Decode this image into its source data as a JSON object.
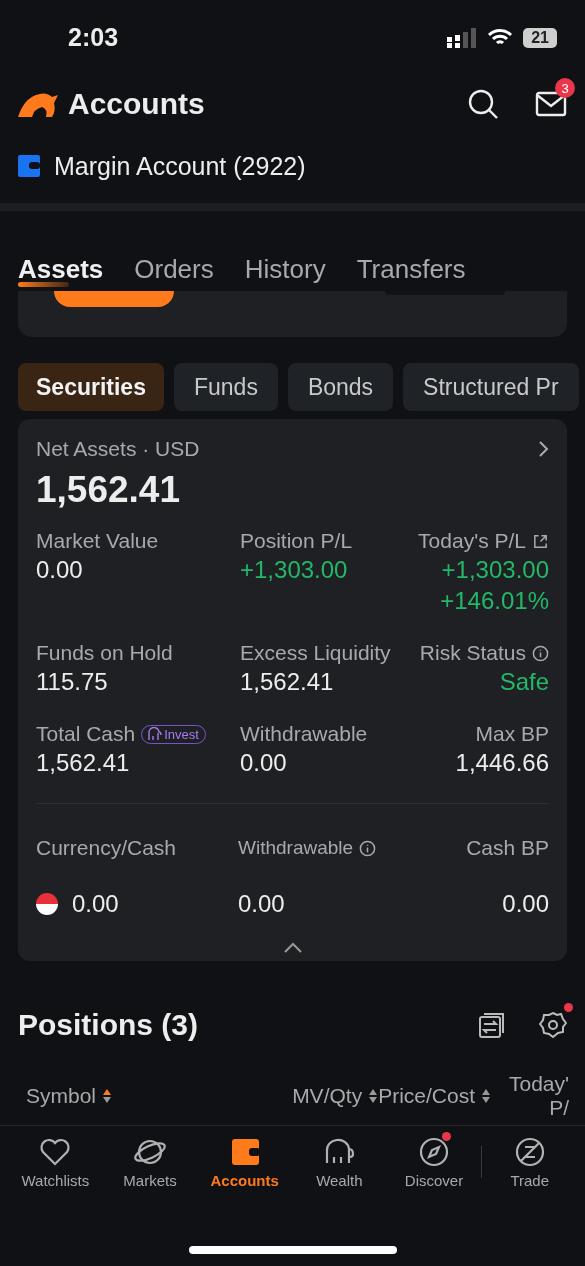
{
  "status_bar": {
    "time": "2:03",
    "battery": "21"
  },
  "header": {
    "title": "Accounts",
    "mail_badge": "3"
  },
  "account": {
    "name": "Margin Account (2922)"
  },
  "tabs": [
    {
      "label": "Assets",
      "selected": true
    },
    {
      "label": "Orders",
      "selected": false
    },
    {
      "label": "History",
      "selected": false
    },
    {
      "label": "Transfers",
      "selected": false
    }
  ],
  "segments": [
    {
      "label": "Securities",
      "selected": true
    },
    {
      "label": "Funds",
      "selected": false
    },
    {
      "label": "Bonds",
      "selected": false
    },
    {
      "label": "Structured Pr",
      "selected": false
    }
  ],
  "summary": {
    "title": "Net Assets · USD",
    "value": "1,562.41",
    "metrics": [
      {
        "label": "Market Value",
        "value": "0.00",
        "gain": false
      },
      {
        "label": "Position P/L",
        "value": "+1,303.00",
        "gain": true
      },
      {
        "label": "Today's P/L",
        "kind": "share",
        "value": "+1,303.00",
        "sub": "+146.01%",
        "gain": true
      },
      {
        "label": "Funds on Hold",
        "value": "115.75",
        "gain": false
      },
      {
        "label": "Excess Liquidity",
        "value": "1,562.41",
        "gain": false
      },
      {
        "label": "Risk Status",
        "kind": "info",
        "value": "Safe",
        "gain": true
      },
      {
        "label": "Total Cash",
        "badge": "Invest",
        "value": "1,562.41",
        "gain": false
      },
      {
        "label": "Withdrawable",
        "value": "0.00",
        "gain": false
      },
      {
        "label": "Max BP",
        "value": "1,446.66",
        "gain": false
      }
    ],
    "cash_columns": [
      {
        "label": "Currency/Cash"
      },
      {
        "label": "Withdrawable",
        "kind": "info"
      },
      {
        "label": "Cash BP"
      }
    ],
    "cash_rows": [
      {
        "values": [
          "0.00",
          "0.00",
          "0.00"
        ]
      }
    ]
  },
  "positions": {
    "title": "Positions (3)",
    "settings_dot": true,
    "columns": [
      {
        "label": "Symbol",
        "sorted": true
      },
      {
        "label": "MV/Qty",
        "sorted": false
      },
      {
        "label": "Price/Cost",
        "sorted": false
      },
      {
        "label": "Today' P/"
      }
    ]
  },
  "nav": [
    {
      "label": "Watchlists",
      "kind": "heart",
      "selected": false,
      "dot": false
    },
    {
      "label": "Markets",
      "kind": "planet",
      "selected": false,
      "dot": false
    },
    {
      "label": "Accounts",
      "kind": "wallet",
      "selected": true,
      "dot": false
    },
    {
      "label": "Wealth",
      "kind": "elephant",
      "selected": false,
      "dot": false
    },
    {
      "label": "Discover",
      "kind": "compass",
      "selected": false,
      "dot": true
    },
    {
      "label": "Trade",
      "kind": "trade",
      "selected": false,
      "dot": false
    }
  ]
}
